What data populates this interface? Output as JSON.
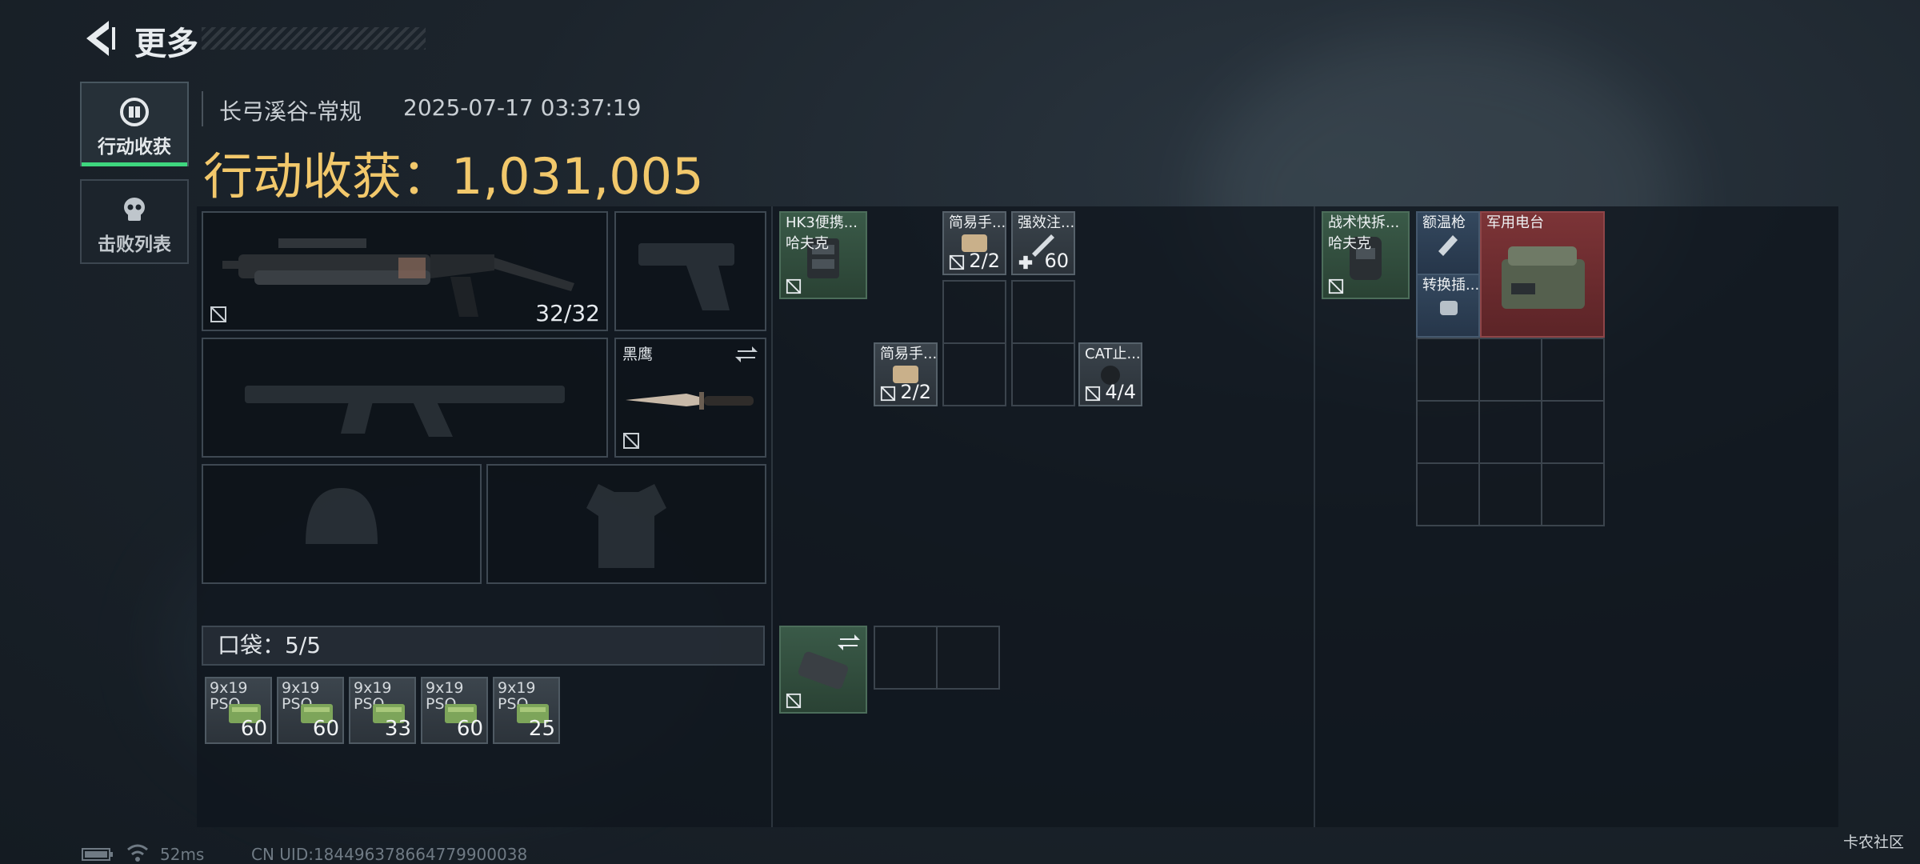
{
  "header": {
    "back_label": "back",
    "title": "更多"
  },
  "tabs": [
    {
      "label": "行动收获",
      "icon": "loot-icon",
      "active": true
    },
    {
      "label": "击败列表",
      "icon": "skull-icon",
      "active": false
    }
  ],
  "raid": {
    "map": "长弓溪谷-常规",
    "timestamp": "2025-07-17 03:37:19",
    "gain_label": "行动收获：",
    "gain_value": "1,031,005"
  },
  "loadout": {
    "primary_ammo": "32/32",
    "melee_label": "黑鹰",
    "pocket_label": "口袋：",
    "pocket_count": "5/5",
    "pocket_items": [
      {
        "cal1": "9x19",
        "cal2": "PSO",
        "count": "60"
      },
      {
        "cal1": "9x19",
        "cal2": "PSO",
        "count": "60"
      },
      {
        "cal1": "9x19",
        "cal2": "PSO",
        "count": "33"
      },
      {
        "cal1": "9x19",
        "cal2": "PSO",
        "count": "60"
      },
      {
        "cal1": "9x19",
        "cal2": "PSO",
        "count": "25"
      }
    ]
  },
  "rig": {
    "items": [
      {
        "label1": "HK3便携...",
        "label2": "哈夫克"
      },
      {
        "label": "简易手...",
        "count": "2/2"
      },
      {
        "label": "强效注...",
        "count": "60"
      },
      {
        "label": "简易手...",
        "count": "2/2"
      },
      {
        "label": "CAT止...",
        "count": "4/4"
      }
    ]
  },
  "backpack": {
    "items": [
      {
        "label1": "战术快拆...",
        "label2": "哈夫克"
      },
      {
        "label": "额温枪"
      },
      {
        "label": "转换插..."
      },
      {
        "label": "军用电台"
      }
    ]
  },
  "status": {
    "latency": "52ms",
    "uid": "CN UID:1844963786647799000​38"
  },
  "watermark": "卡农社区",
  "colors": {
    "accent_green": "#3ed67e",
    "gain_gold": "#f2c86b",
    "rare_red": "#7c3437"
  }
}
